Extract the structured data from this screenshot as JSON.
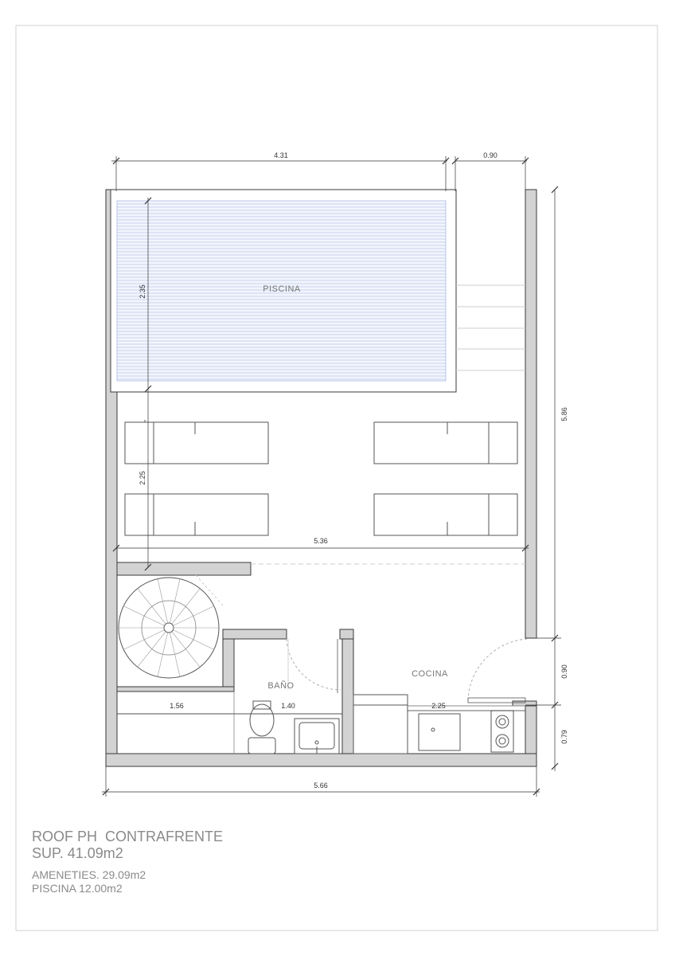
{
  "plan": {
    "rooms": {
      "pool": "PISCINA",
      "bath": "BAÑO",
      "kitchen": "COCINA"
    },
    "dimensions": {
      "pool_width": "4.31",
      "side_strip": "0.90",
      "pool_depth": "2.35",
      "deck_depth": "2.25",
      "terrace_width": "5.36",
      "total_height": "5.86",
      "door_opening": "0.90",
      "counter_depth": "0.79",
      "storage_width": "1.56",
      "bath_width": "1.40",
      "kitchen_width": "2.25",
      "total_width": "5.66"
    }
  },
  "title_block": {
    "title": "ROOF PH  CONTRAFRENTE",
    "total_area": "SUP. 41.09m2",
    "amenities_area": "AMENETIES. 29.09m2",
    "pool_area": "PISCINA 12.00m2"
  },
  "colors": {
    "wall_fill": "#d3d3d3",
    "line": "#3a3a3a",
    "water": "#8fa6dc",
    "frame": "#d0d0d0"
  }
}
